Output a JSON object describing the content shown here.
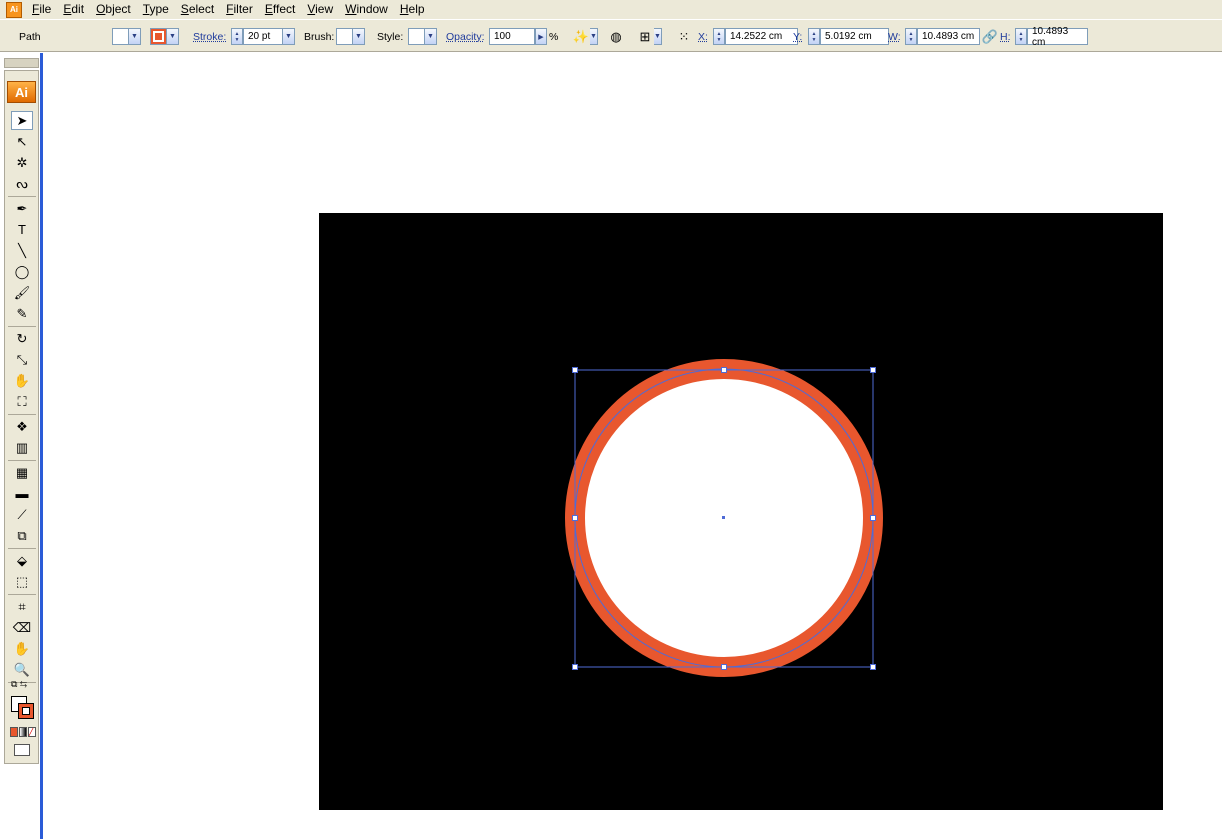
{
  "menu": [
    "File",
    "Edit",
    "Object",
    "Type",
    "Select",
    "Filter",
    "Effect",
    "View",
    "Window",
    "Help"
  ],
  "control_bar": {
    "selection_type": "Path",
    "stroke_label": "Stroke:",
    "stroke_weight": "20 pt",
    "brush_label": "Brush:",
    "style_label": "Style:",
    "opacity_label": "Opacity:",
    "opacity_value": "100",
    "opacity_unit": "%",
    "x_label": "X:",
    "x_value": "14.2522 cm",
    "y_label": "Y:",
    "y_value": "5.0192 cm",
    "w_label": "W:",
    "w_value": "10.4893 cm",
    "h_label": "H:",
    "h_value": "10.4893 cm"
  },
  "tools_panel": {
    "logo": "Ai",
    "tools": [
      {
        "name": "selection-tool",
        "icon": "➤",
        "selected": true
      },
      {
        "name": "direct-selection-tool",
        "icon": "↖",
        "selected": false
      },
      {
        "name": "magic-wand-tool",
        "icon": "✲",
        "selected": false
      },
      {
        "name": "lasso-tool",
        "icon": "ᔓ",
        "selected": false
      },
      {
        "name": "pen-tool",
        "icon": "✒",
        "selected": false
      },
      {
        "name": "type-tool",
        "icon": "T",
        "selected": false
      },
      {
        "name": "line-segment-tool",
        "icon": "╲",
        "selected": false
      },
      {
        "name": "ellipse-tool",
        "icon": "◯",
        "selected": false
      },
      {
        "name": "paintbrush-tool",
        "icon": "🖌",
        "selected": false
      },
      {
        "name": "pencil-tool",
        "icon": "✎",
        "selected": false
      },
      {
        "name": "rotate-tool",
        "icon": "↻",
        "selected": false
      },
      {
        "name": "scale-tool",
        "icon": "⤡",
        "selected": false
      },
      {
        "name": "warp-tool",
        "icon": "✋",
        "selected": false
      },
      {
        "name": "free-transform-tool",
        "icon": "⛶",
        "selected": false
      },
      {
        "name": "symbol-sprayer-tool",
        "icon": "❖",
        "selected": false
      },
      {
        "name": "column-graph-tool",
        "icon": "▥",
        "selected": false
      },
      {
        "name": "mesh-tool",
        "icon": "▦",
        "selected": false
      },
      {
        "name": "gradient-tool",
        "icon": "▬",
        "selected": false
      },
      {
        "name": "eyedropper-tool",
        "icon": "⟋",
        "selected": false
      },
      {
        "name": "blend-tool",
        "icon": "⧉",
        "selected": false
      },
      {
        "name": "live-paint-bucket-tool",
        "icon": "⬙",
        "selected": false
      },
      {
        "name": "live-paint-selection-tool",
        "icon": "⬚",
        "selected": false
      },
      {
        "name": "crop-area-tool",
        "icon": "⌗",
        "selected": false
      },
      {
        "name": "eraser-tool",
        "icon": "⌫",
        "selected": false
      },
      {
        "name": "hand-tool",
        "icon": "✋",
        "selected": false
      },
      {
        "name": "zoom-tool",
        "icon": "🔍",
        "selected": false
      }
    ]
  },
  "colors": {
    "stroke": "#e8572e",
    "fill": "#ffffff",
    "artboard": "#000000",
    "selection": "#4f6bd6"
  }
}
